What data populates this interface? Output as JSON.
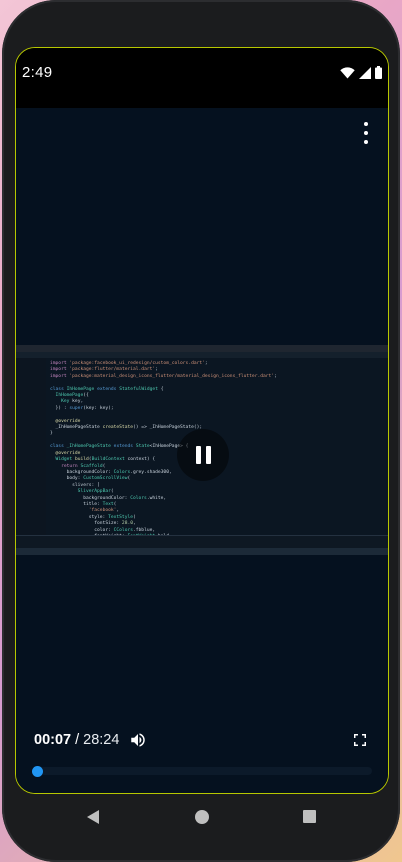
{
  "status_bar": {
    "time": "2:49",
    "icons": [
      "wifi-icon",
      "signal-icon",
      "battery-icon"
    ]
  },
  "video": {
    "menu_icon": "more-vert-icon",
    "pause_icon": "pause-icon",
    "current_time": "00:07",
    "separator": "/",
    "duration": "28:24",
    "volume_icon": "volume-up-icon",
    "fullscreen_icon": "fullscreen-icon",
    "progress_fraction": 0.004,
    "accent_color": "#2196f3"
  },
  "nav_bar": {
    "icons": [
      "back-icon",
      "home-icon",
      "recents-icon"
    ]
  }
}
